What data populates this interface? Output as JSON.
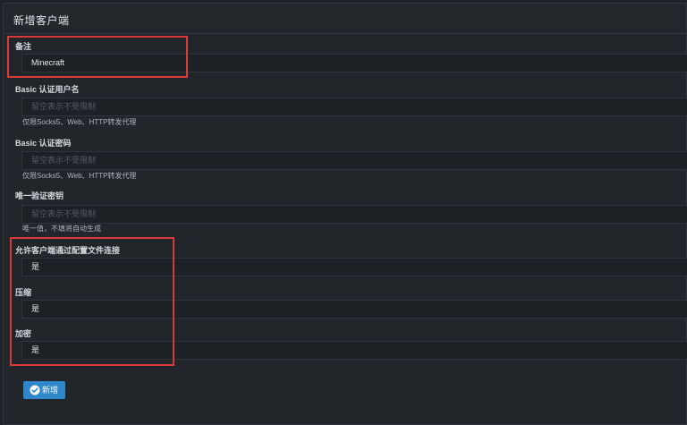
{
  "header": {
    "title": "新增客户端"
  },
  "form": {
    "remark": {
      "label": "备注",
      "value": "Minecraft"
    },
    "basic_user": {
      "label": "Basic 认证用户名",
      "placeholder": "留空表示不受限制",
      "help": "仅限Socks5、Web、HTTP转发代理"
    },
    "basic_pass": {
      "label": "Basic 认证密码",
      "placeholder": "留空表示不受限制",
      "help": "仅限Socks5、Web、HTTP转发代理"
    },
    "unique_key": {
      "label": "唯一验证密钥",
      "placeholder": "留空表示不受限制",
      "help": "唯一值，不填将自动生成"
    },
    "allow_config": {
      "label": "允许客户端通过配置文件连接",
      "value": "是"
    },
    "compress": {
      "label": "压缩",
      "value": "是"
    },
    "encrypt": {
      "label": "加密",
      "value": "是"
    }
  },
  "submit": {
    "label": "新增",
    "icon": "check-circle-icon"
  },
  "colors": {
    "highlight": "#d93a3a",
    "button": "#2f86c9",
    "background": "#22262b"
  }
}
